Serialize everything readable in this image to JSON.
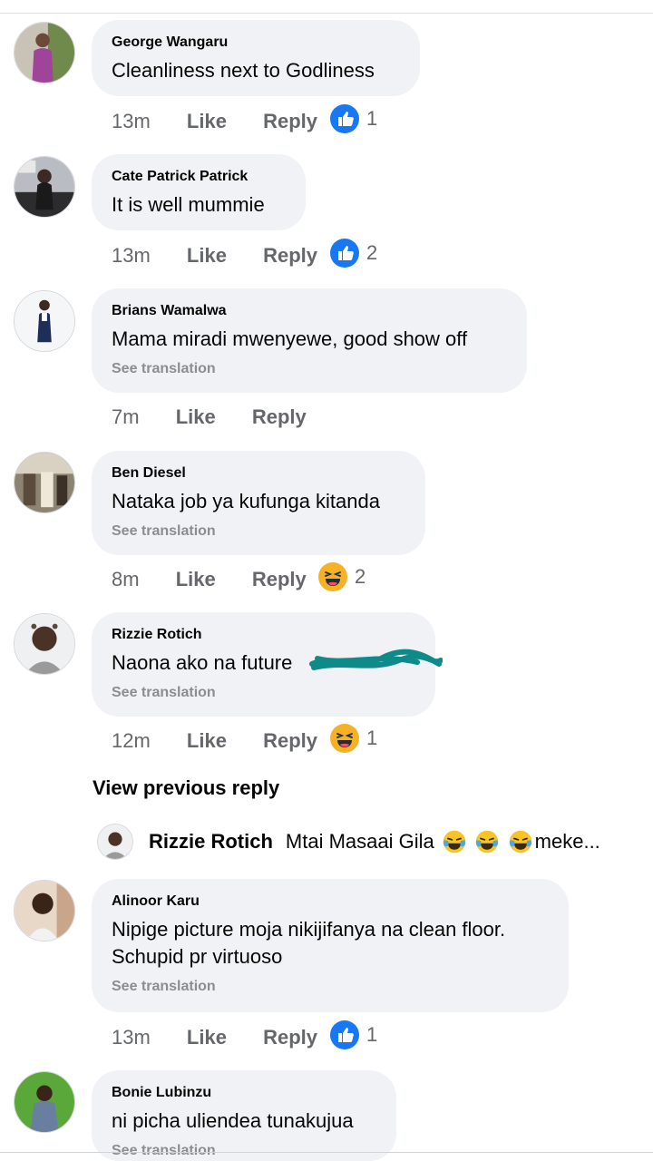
{
  "comments": [
    {
      "name": "George Wangaru",
      "text": "Cleanliness next to Godliness",
      "time": "13m",
      "like": "Like",
      "reply": "Reply",
      "reaction": "like-icon",
      "reaction_count": "1"
    },
    {
      "name": "Cate Patrick Patrick",
      "text": "It is well mummie",
      "time": "13m",
      "like": "Like",
      "reply": "Reply",
      "reaction": "like-icon",
      "reaction_count": "2"
    },
    {
      "name": "Brians Wamalwa",
      "text": "Mama miradi mwenyewe, good show off",
      "see_translation": "See translation",
      "time": "7m",
      "like": "Like",
      "reply": "Reply"
    },
    {
      "name": "Ben Diesel",
      "text": "Nataka job ya kufunga kitanda",
      "see_translation": "See translation",
      "time": "8m",
      "like": "Like",
      "reply": "Reply",
      "reaction": "haha-icon",
      "reaction_count": "2"
    },
    {
      "name": "Rizzie Rotich",
      "text": "Naona ako na future",
      "see_translation": "See translation",
      "time": "12m",
      "like": "Like",
      "reply": "Reply",
      "reaction": "haha-icon",
      "reaction_count": "1"
    },
    {
      "name": "Alinoor Karu",
      "text": "Nipige picture moja nikijifanya na clean floor.",
      "text2": "Schupid pr virtuoso",
      "see_translation": "See translation",
      "time": "13m",
      "like": "Like",
      "reply": "Reply",
      "reaction": "like-icon",
      "reaction_count": "1"
    },
    {
      "name": "Bonie Lubinzu",
      "text": "ni picha uliendea tunakujua",
      "see_translation": "See translation"
    }
  ],
  "view_previous_reply": "View previous reply",
  "reply_preview": {
    "name": "Rizzie Rotich",
    "text": "Mtai Masaai Gila",
    "text_after": "meke..."
  },
  "colors": {
    "bubble": "#f0f2f5",
    "meta": "#65676b",
    "muted": "#8a8d91",
    "like_blue": "#1877f2",
    "haha_yellow": "#f7b125"
  }
}
